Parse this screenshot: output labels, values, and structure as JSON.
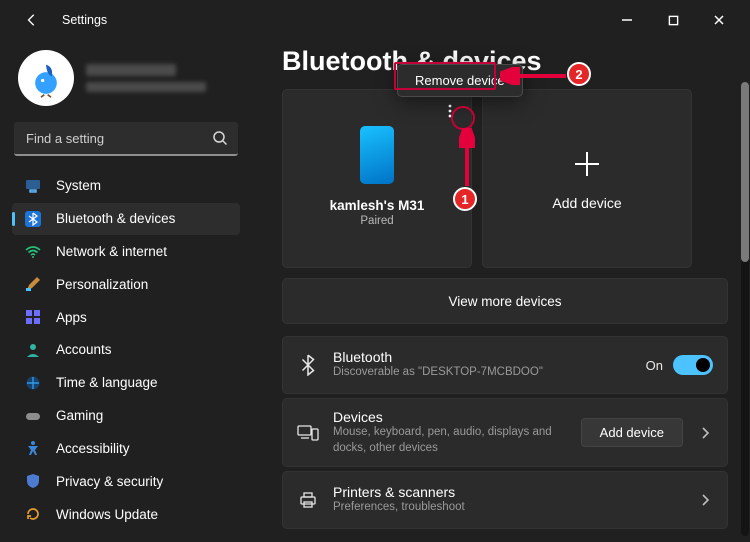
{
  "window": {
    "title": "Settings"
  },
  "search": {
    "placeholder": "Find a setting"
  },
  "nav": [
    {
      "label": "System"
    },
    {
      "label": "Bluetooth & devices",
      "active": true
    },
    {
      "label": "Network & internet"
    },
    {
      "label": "Personalization"
    },
    {
      "label": "Apps"
    },
    {
      "label": "Accounts"
    },
    {
      "label": "Time & language"
    },
    {
      "label": "Gaming"
    },
    {
      "label": "Accessibility"
    },
    {
      "label": "Privacy & security"
    },
    {
      "label": "Windows Update"
    }
  ],
  "page": {
    "title": "Bluetooth & devices"
  },
  "device_card": {
    "name": "kamlesh's M31",
    "status": "Paired"
  },
  "add_card": {
    "label": "Add device"
  },
  "view_more": {
    "label": "View more devices"
  },
  "rows": {
    "bluetooth": {
      "title": "Bluetooth",
      "subtitle": "Discoverable as \"DESKTOP-7MCBDOO\"",
      "toggle_label": "On"
    },
    "devices": {
      "title": "Devices",
      "subtitle": "Mouse, keyboard, pen, audio, displays and docks, other devices",
      "button": "Add device"
    },
    "printers": {
      "title": "Printers & scanners",
      "subtitle": "Preferences, troubleshoot"
    }
  },
  "context_menu": {
    "remove": "Remove device"
  },
  "annotations": {
    "step1": "1",
    "step2": "2"
  }
}
